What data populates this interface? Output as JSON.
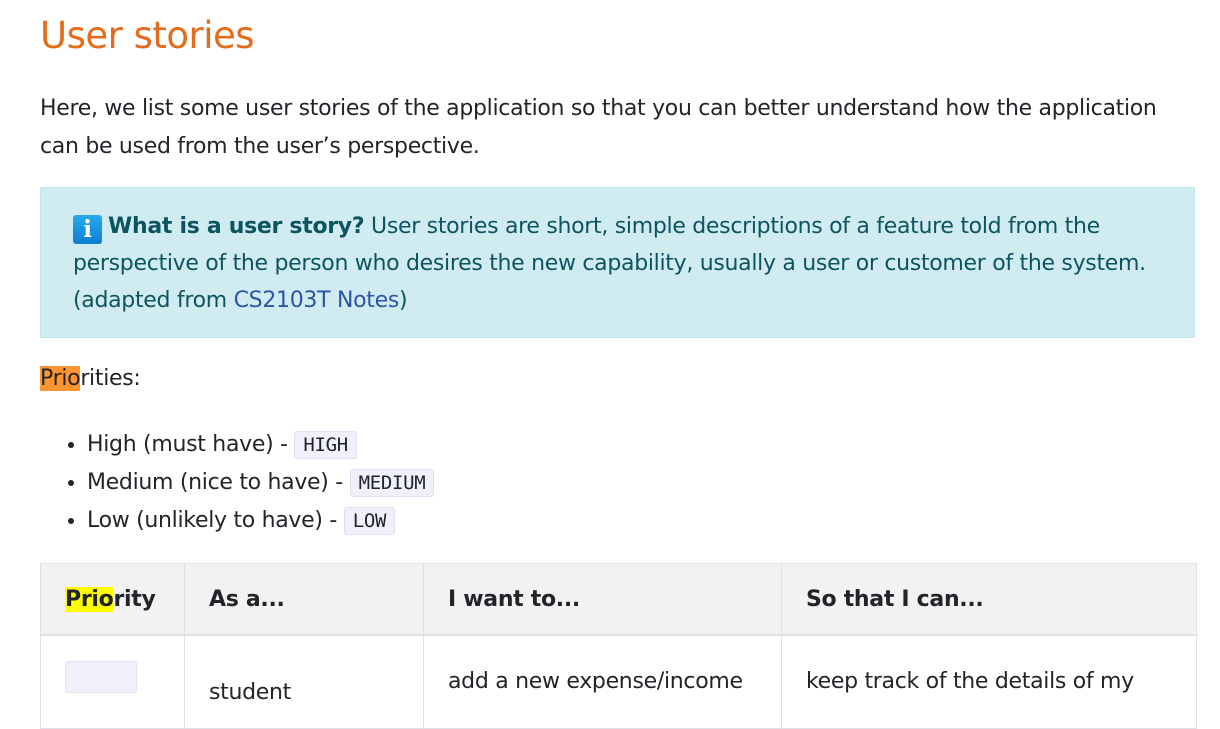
{
  "heading": "User stories",
  "intro": "Here, we list some user stories of the application so that you can better understand how the application can be used from the user’s perspective.",
  "alert": {
    "icon": "info-icon",
    "icon_glyph": "i",
    "title": "What is a user story?",
    "text": " User stories are short, simple descriptions of a feature told from the perspective of the person who desires the new capability, usually a user or customer of the system. (adapted from ",
    "link": "CS2103T Notes",
    "suffix": ")"
  },
  "priorities": {
    "label_highlight": "Prio",
    "label_rest": "rities:",
    "items": [
      {
        "text": "High (must have) - ",
        "code": "HIGH"
      },
      {
        "text": "Medium (nice to have) - ",
        "code": "MEDIUM"
      },
      {
        "text": "Low (unlikely to have) - ",
        "code": "LOW"
      }
    ]
  },
  "table": {
    "headers": [
      {
        "highlight": "Prio",
        "rest": "rity"
      },
      {
        "rest": "As a..."
      },
      {
        "rest": "I want to..."
      },
      {
        "rest": "So that I can..."
      }
    ],
    "rows": [
      {
        "as_a": "student",
        "want": "add a new expense/income",
        "so_that": "keep track of the details of my"
      }
    ]
  },
  "colors": {
    "heading": "#e46c1d",
    "alert_bg": "#d1ecf1",
    "link": "#2a55a8",
    "find_current": "#ff9632",
    "find_match": "#ffff00"
  }
}
